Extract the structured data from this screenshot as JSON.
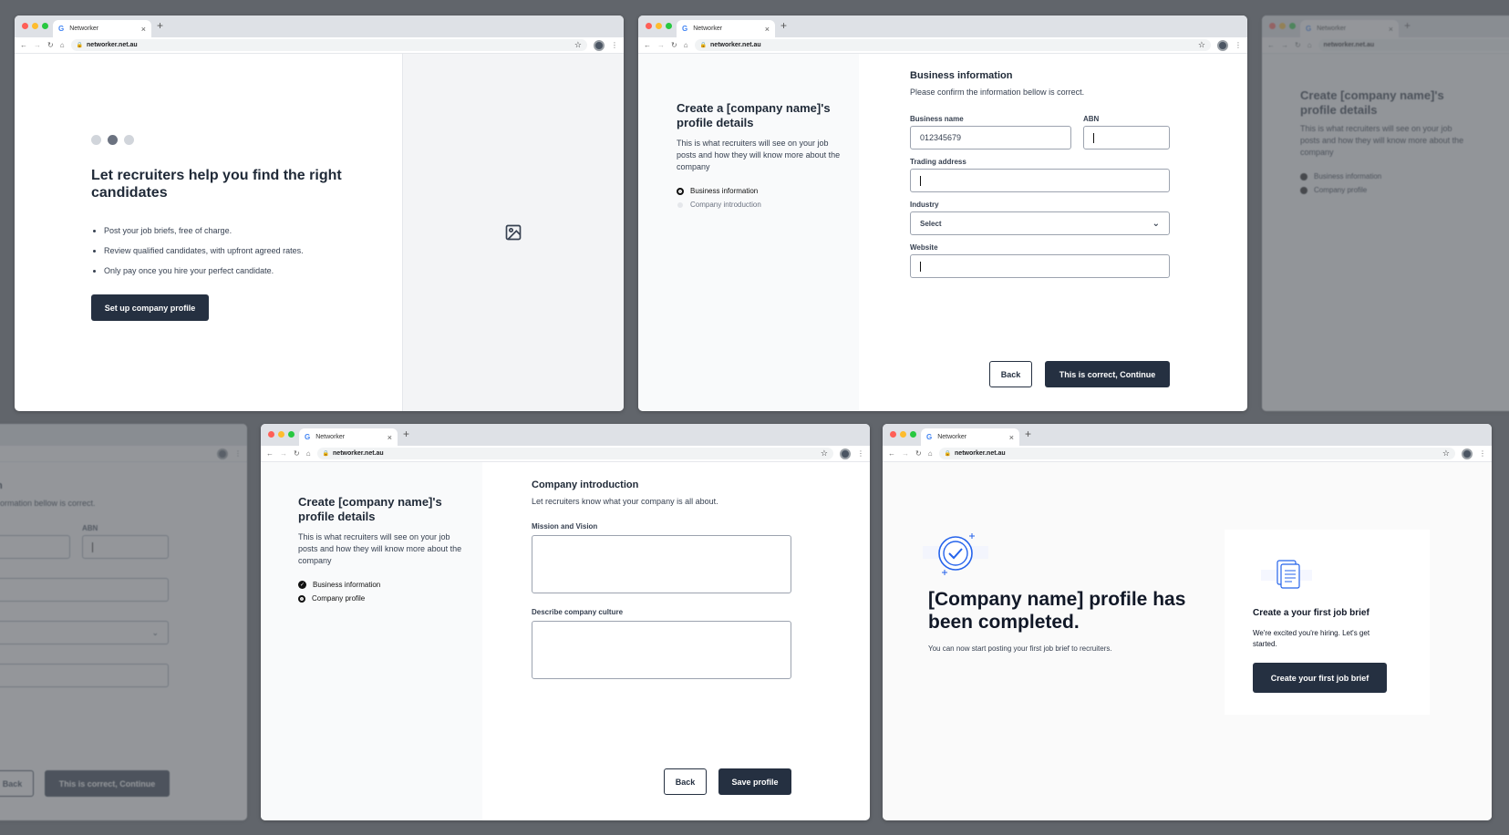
{
  "browser": {
    "tab_title": "Networker",
    "url": "networker.net.au"
  },
  "welcome": {
    "heading": "Let recruiters help you find the right candidates",
    "bullets": [
      "Post your job briefs, free of charge.",
      "Review qualified candidates, with upfront agreed rates.",
      "Only pay once you hire your perfect candidate."
    ],
    "cta_label": "Set up company profile"
  },
  "business_info": {
    "side_title": "Create a [company name]'s profile details",
    "side_desc": "This is what recruiters will see on your job posts and how they will know more about the company",
    "steps": [
      "Business information",
      "Company introduction"
    ],
    "title": "Business information",
    "subtitle": "Please confirm the information bellow is correct.",
    "business_name_label": "Business name",
    "business_name_value": "012345679",
    "abn_label": "ABN",
    "trading_address_label": "Trading address",
    "industry_label": "Industry",
    "industry_value": "Select",
    "website_label": "Website",
    "back_label": "Back",
    "continue_label": "This is correct, Continue"
  },
  "faded_right": {
    "title": "Create [company name]'s profile details",
    "desc": "This is what recruiters will see on your job posts and how they will know more about the company",
    "steps": [
      "Business information",
      "Company profile"
    ]
  },
  "faded_left": {
    "title_fragment": "n",
    "subtitle_fragment": "ormation bellow is correct.",
    "abn_label": "ABN",
    "back_label": "Back",
    "continue_label": "This is correct, Continue"
  },
  "company_intro": {
    "side_title": "Create [company name]'s profile details",
    "side_desc": "This is what recruiters will see on your job posts and how they will know more about the company",
    "steps": [
      "Business information",
      "Company profile"
    ],
    "title": "Company introduction",
    "subtitle": "Let recruiters know what your company is all about.",
    "mission_label": "Mission and Vision",
    "culture_label": "Describe company culture",
    "back_label": "Back",
    "save_label": "Save profile"
  },
  "completed": {
    "heading": "[Company name] profile has been completed.",
    "desc": "You can now start posting your first job brief to recruiters.",
    "card_title": "Create a your first job brief",
    "card_desc": "We're excited you're hiring. Let's get started.",
    "card_cta": "Create your first job brief"
  },
  "colors": {
    "background": "#61656b",
    "primary_button": "#253041",
    "accent_blue": "#2563eb"
  }
}
